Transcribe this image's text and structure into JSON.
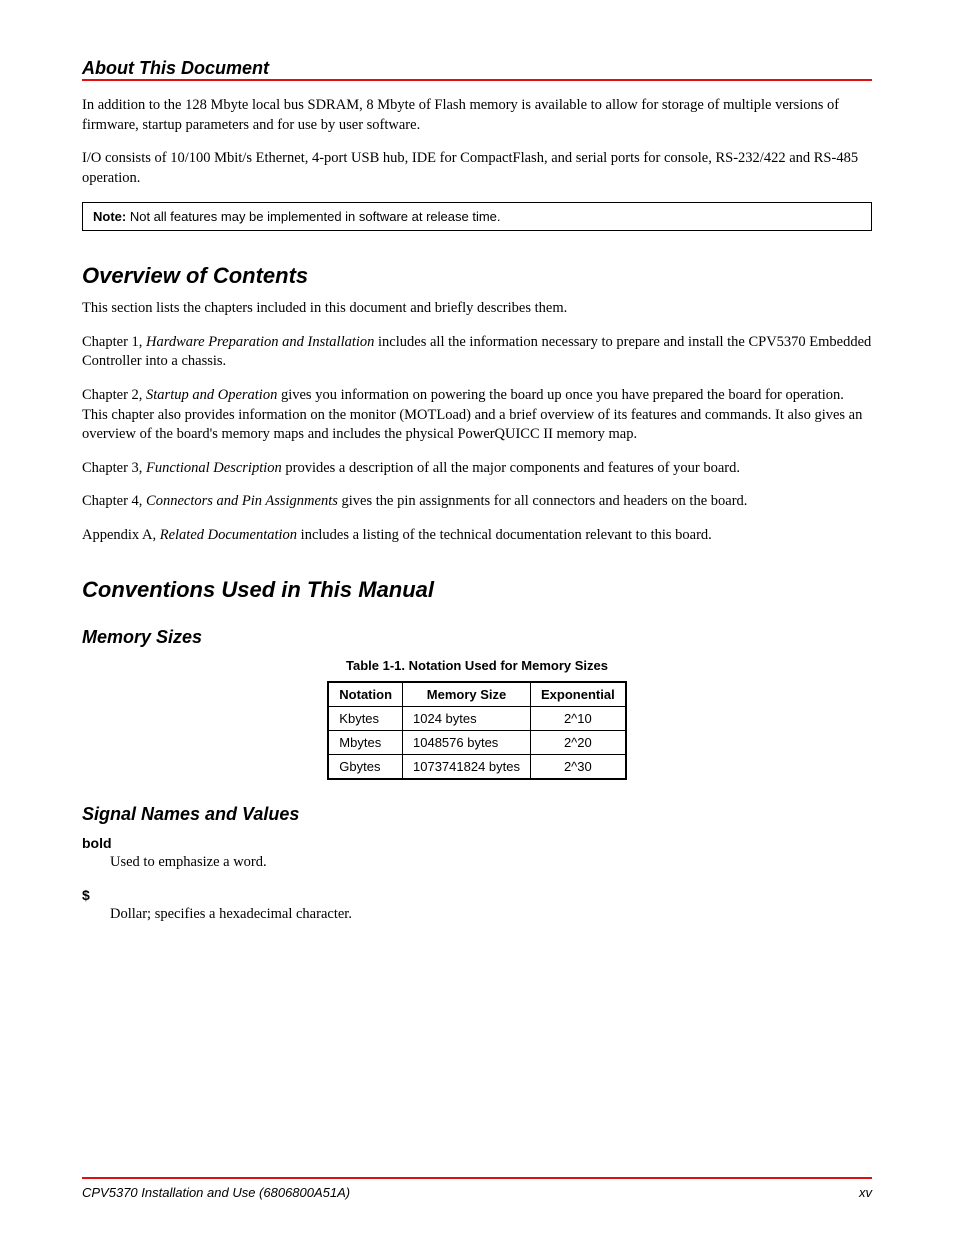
{
  "header": {
    "title": "About This Document"
  },
  "intro": {
    "p1": "In addition to the 128 Mbyte local bus SDRAM, 8 Mbyte of Flash memory is available to allow for storage of multiple versions of firmware, startup parameters and for use by user software.",
    "p2": "I/O consists of 10/100 Mbit/s Ethernet, 4-port USB hub, IDE for CompactFlash, and serial ports for console, RS-232/422 and RS-485 operation."
  },
  "note": {
    "label": "Note:",
    "text": "Not all features may be implemented in software at release time."
  },
  "sec_overview": {
    "heading": "Overview of Contents",
    "p1": "This section lists the chapters included in this document and briefly describes them.",
    "p2_a": "Chapter 1, ",
    "p2_link": "Hardware Preparation and Installation",
    "p2_b": " includes all the information necessary to prepare and install the CPV5370 Embedded Controller into a chassis.",
    "p3_a": "Chapter 2, ",
    "p3_link": "Startup and Operation",
    "p3_b": " gives you information on powering the board up once you have prepared the board for operation. This chapter also provides information on the monitor (MOTLoad) and a brief overview of its features and commands. It also gives an overview of the board's memory maps and includes the physical PowerQUICC II memory map.",
    "p4_a": "Chapter 3, ",
    "p4_link": "Functional Description",
    "p4_b": " provides a description of all the major components and features of your board.",
    "p5_a": "Chapter 4, ",
    "p5_link": "Connectors and Pin Assignments",
    "p5_b": " gives the pin assignments for all connectors and headers on the board.",
    "p6_a": "Appendix A, ",
    "p6_link": "Related Documentation",
    "p6_b": " includes a listing of the technical documentation relevant to this board."
  },
  "sec_conventions": {
    "heading": "Conventions Used in This Manual",
    "sub_memory": "Memory Sizes",
    "table_caption": "Table 1-1. Notation Used for Memory Sizes",
    "table": {
      "headers": [
        "Notation",
        "Memory Size",
        "Exponential"
      ],
      "rows": [
        [
          "Kbytes",
          "1024 bytes",
          "2^10"
        ],
        [
          "Mbytes",
          "1048576 bytes",
          "2^20"
        ],
        [
          "Gbytes",
          "1073741824 bytes",
          "2^30"
        ]
      ]
    },
    "sub_signals": "Signal Names and Values",
    "term1": {
      "name": "bold",
      "def": "Used to emphasize a word."
    },
    "term2": {
      "name": "$",
      "def": "Dollar; specifies a hexadecimal character."
    }
  },
  "footer": {
    "left": "CPV5370 Installation and Use (6806800A51A)",
    "right": "xv"
  }
}
